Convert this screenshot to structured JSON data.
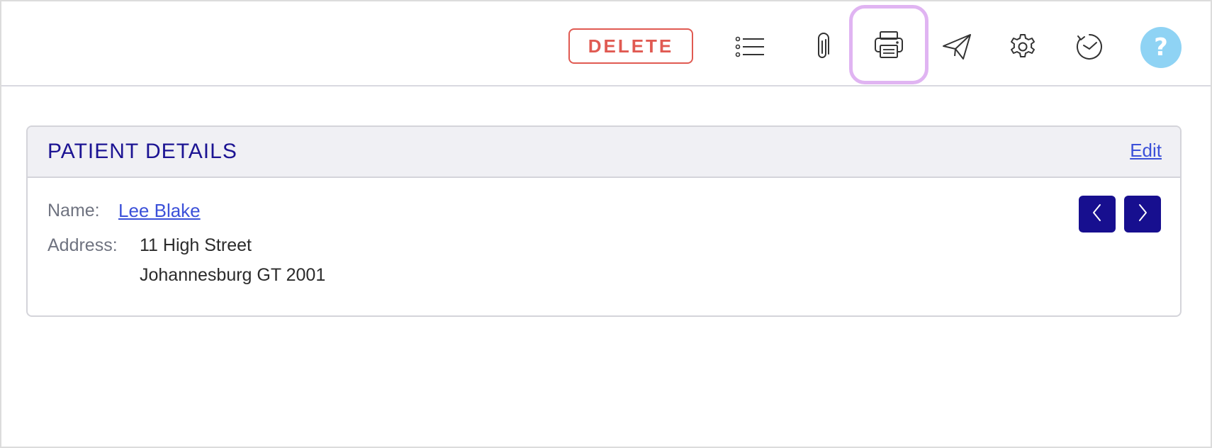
{
  "toolbar": {
    "delete_label": "DELETE",
    "icons": [
      "list-icon",
      "paperclip-icon",
      "printer-icon",
      "send-icon",
      "gear-icon",
      "history-icon",
      "help-icon"
    ],
    "help_label": "?",
    "colors": {
      "delete": "#e05a52",
      "help_bg": "#8fd3f4",
      "highlight": "#e0b4f2"
    }
  },
  "patient_card": {
    "title": "PATIENT DETAILS",
    "edit_label": "Edit",
    "name_label": "Name:",
    "name_value": "Lee Blake",
    "address_label": "Address:",
    "address_line1": "11 High Street",
    "address_line2": "Johannesburg GT 2001",
    "colors": {
      "title": "#1c1493",
      "link": "#3b50d9",
      "nav_bg": "#170f8f"
    }
  }
}
